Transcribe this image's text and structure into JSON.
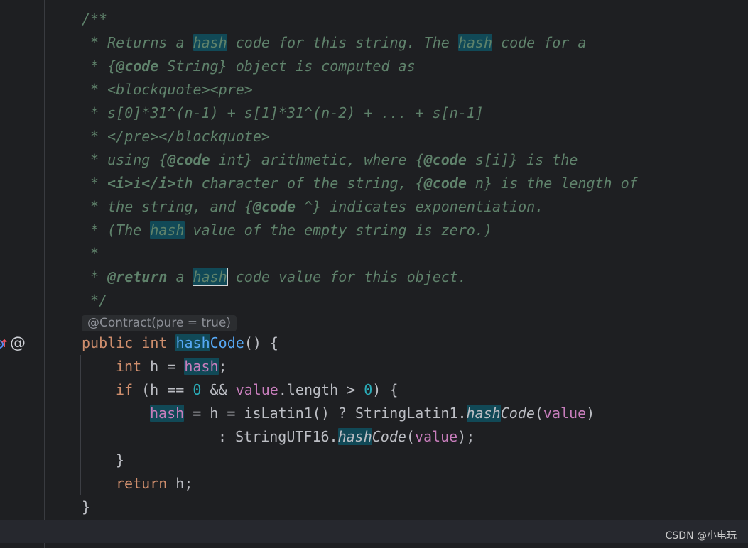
{
  "doc_comment": {
    "l1": "/**",
    "l2": {
      "a": " * Returns a ",
      "h1": "hash",
      "b": " code for this string. The ",
      "h2": "hash",
      "c": " code for a"
    },
    "l3": {
      "a": " * {",
      "tag": "@code",
      "b": " String} object is computed as"
    },
    "l4": " * <blockquote><pre>",
    "l5": " * s[0]*31^(n-1) + s[1]*31^(n-2) + ... + s[n-1]",
    "l6": " * </pre></blockquote>",
    "l7": {
      "a": " * using {",
      "tag1": "@code",
      "b": " int} arithmetic, where {",
      "tag2": "@code",
      "c": " s[i]} is the"
    },
    "l8": {
      "a": " * ",
      "it_open": "<i>",
      "i": "i",
      "it_close": "</i>",
      "b": "th character of the string, {",
      "tag": "@code",
      "c": " n} is the length of"
    },
    "l9": {
      "a": " * the string, and {",
      "tag": "@code",
      "b": " ^} indicates exponentiation."
    },
    "l10": {
      "a": " * (The ",
      "h": "hash",
      "b": " value of the empty string is zero.)"
    },
    "l11": " *",
    "l12": {
      "a": " * ",
      "tag": "@return",
      "b": " a ",
      "h": "hash",
      "c": " code value for this object."
    },
    "l13": " */"
  },
  "inlay_hint": "@Contract(pure = true)",
  "code": {
    "decl": {
      "kw1": "public",
      "kw2": "int",
      "name_hl": "hash",
      "name_rest": "Code",
      "rest": "() {"
    },
    "line1": {
      "kw": "int",
      "a": " h = ",
      "field": "hash",
      "b": ";"
    },
    "line2": {
      "kw": "if",
      "a": " (h == ",
      "n1": "0",
      "b": " && ",
      "field": "value",
      "c": ".length > ",
      "n2": "0",
      "d": ") {"
    },
    "line3": {
      "field": "hash",
      "a": " = h = isLatin1() ? StringLatin1.",
      "m_hl": "hash",
      "m_rest": "Code",
      "b": "(",
      "arg": "value",
      "c": ")"
    },
    "line4": {
      "a": ": StringUTF16.",
      "m_hl": "hash",
      "m_rest": "Code",
      "b": "(",
      "arg": "value",
      "c": ");"
    },
    "line5": "}",
    "line6": {
      "kw": "return",
      "a": " h;"
    },
    "line7": "}"
  },
  "gutter": {
    "icons": [
      "implementation-icon",
      "annotation-icon"
    ],
    "at_glyph": "@"
  },
  "watermark": "CSDN @小电玩",
  "colors": {
    "background": "#1e1f22",
    "doc_comment": "#5f826b",
    "keyword": "#cf8e6d",
    "number": "#2aacb8",
    "field": "#c77dbb",
    "method_declaration": "#56a8f5",
    "identifier_highlight": "#114957"
  }
}
